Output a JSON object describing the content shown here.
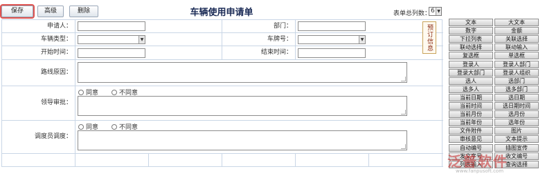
{
  "toolbar": {
    "save_label": "保存",
    "advanced_label": "高级",
    "delete_label": "删除"
  },
  "form_title": "车辆使用申请单",
  "column_count": {
    "label": "表单总列数：",
    "value": "6"
  },
  "fields": {
    "applicant": "申请人：",
    "department": "部门：",
    "vehicle_type": "车辆类型：",
    "plate_number": "车牌号：",
    "start_time": "开始时间：",
    "end_time": "结束时间：",
    "route_reason": "路线原因：",
    "leader_approval": "领导审批：",
    "dispatcher": "调度员调度："
  },
  "radio_options": {
    "agree": "同意",
    "disagree": "不同意"
  },
  "side_note": "预订信息",
  "palette": [
    [
      "文本",
      "大文本"
    ],
    [
      "数字",
      "金额"
    ],
    [
      "下拉列表",
      "关联选择"
    ],
    [
      "联动选择",
      "联动输入"
    ],
    [
      "复选框",
      "单选框"
    ],
    [
      "登录人",
      "登录人部门"
    ],
    [
      "登录大部门",
      "登录人组织"
    ],
    [
      "选人",
      "选部门"
    ],
    [
      "选多人",
      "选多部门"
    ],
    [
      "当前日期",
      "选日期"
    ],
    [
      "当前时间",
      "选日期时间"
    ],
    [
      "当前月份",
      "选月份"
    ],
    [
      "当前年份",
      "选年份"
    ],
    [
      "文件附件",
      "图片"
    ],
    [
      "审核意见",
      "文本提示"
    ],
    [
      "自动编号",
      "插图宣传"
    ],
    [
      "发文字号",
      "收文编号"
    ],
    [
      "列表输入",
      "查询选择"
    ]
  ],
  "watermark": {
    "text": "泛普软件",
    "url": "www.fanpusoft.com"
  }
}
